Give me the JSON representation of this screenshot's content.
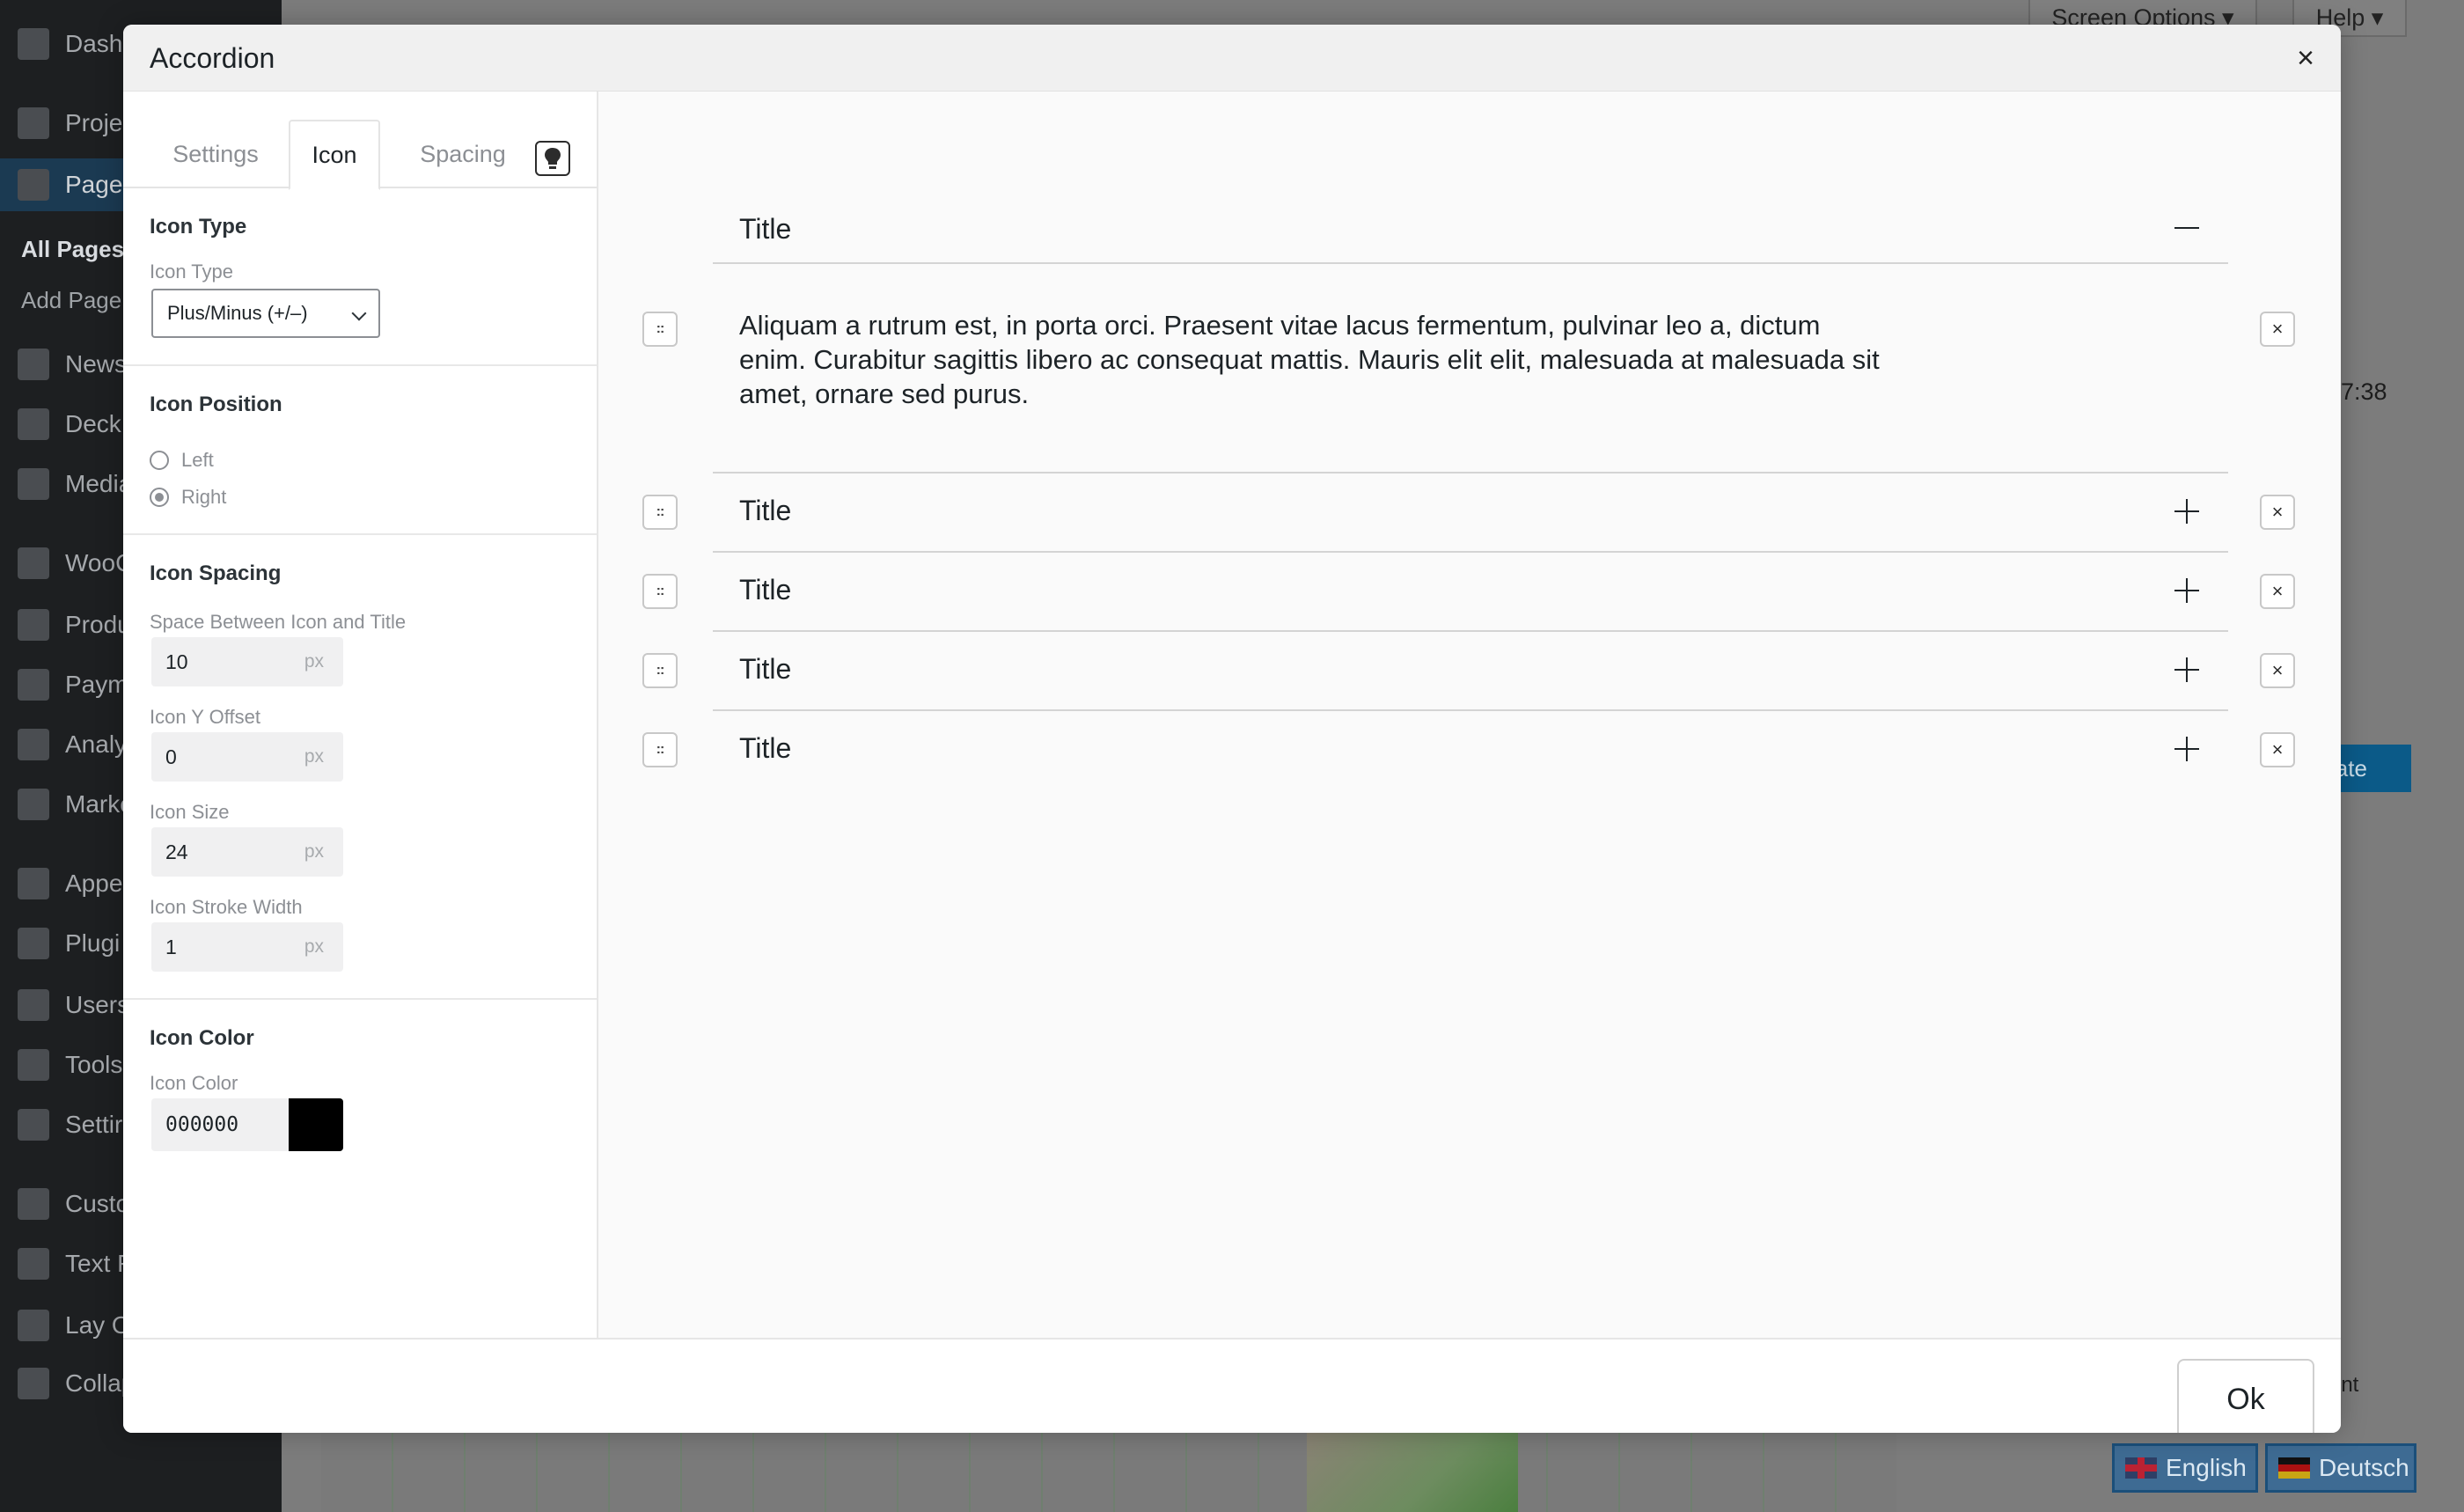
{
  "background": {
    "menu": [
      {
        "label": "Dash",
        "icon": "dashboard-icon"
      },
      {
        "label": "Proje",
        "icon": "pin-icon"
      },
      {
        "label": "Pages",
        "icon": "pages-icon",
        "current": true
      },
      {
        "label": "News",
        "icon": "news-icon"
      },
      {
        "label": "Deck",
        "icon": "deck-icon"
      },
      {
        "label": "Media",
        "icon": "media-icon"
      },
      {
        "label": "WooC",
        "icon": "woo-icon"
      },
      {
        "label": "Produ",
        "icon": "products-icon"
      },
      {
        "label": "Paym",
        "icon": "payments-icon"
      },
      {
        "label": "Analy",
        "icon": "analytics-icon"
      },
      {
        "label": "Marke",
        "icon": "marketing-icon"
      },
      {
        "label": "Appe",
        "icon": "appearance-icon"
      },
      {
        "label": "Plugi",
        "icon": "plugins-icon"
      },
      {
        "label": "Users",
        "icon": "users-icon"
      },
      {
        "label": "Tools",
        "icon": "tools-icon"
      },
      {
        "label": "Settir",
        "icon": "settings-icon"
      },
      {
        "label": "Custo",
        "icon": "eye-icon"
      },
      {
        "label": "Text F",
        "icon": "text-icon"
      },
      {
        "label": "Lay O",
        "icon": "gear-icon"
      },
      {
        "label": "Collap",
        "icon": "collapse-icon"
      }
    ],
    "submenu": [
      "All Pages",
      "Add Page"
    ],
    "screen_options": "Screen Options ▾",
    "help": "Help ▾",
    "time_fragment": "7:38",
    "update_fragment": "late",
    "int_fragment": "int",
    "languages": [
      "English",
      "Deutsch"
    ]
  },
  "modal": {
    "title": "Accordion",
    "close_symbol": "×",
    "tabs": [
      "Settings",
      "Icon",
      "Spacing"
    ],
    "active_tab": "Icon",
    "sections": {
      "icon_type": {
        "title": "Icon Type",
        "label": "Icon Type",
        "value": "Plus/Minus (+/–)"
      },
      "icon_position": {
        "title": "Icon Position",
        "options": [
          "Left",
          "Right"
        ],
        "selected": "Right"
      },
      "icon_spacing": {
        "title": "Icon Spacing",
        "fields": [
          {
            "label": "Space Between Icon and Title",
            "value": "10",
            "unit": "px"
          },
          {
            "label": "Icon Y Offset",
            "value": "0",
            "unit": "px"
          },
          {
            "label": "Icon Size",
            "value": "24",
            "unit": "px"
          },
          {
            "label": "Icon Stroke Width",
            "value": "1",
            "unit": "px"
          }
        ]
      },
      "icon_color": {
        "title": "Icon Color",
        "label": "Icon Color",
        "value": "000000",
        "swatch": "#000000"
      }
    },
    "preview": {
      "items": [
        {
          "title": "Title",
          "expanded": true,
          "body": "Aliquam a rutrum est, in porta orci. Praesent vitae lacus fermentum, pulvinar leo a, dictum enim. Curabitur sagittis libero ac consequat mattis. Mauris elit elit, malesuada at malesuada sit amet, ornare sed purus."
        },
        {
          "title": "Title",
          "expanded": false
        },
        {
          "title": "Title",
          "expanded": false
        },
        {
          "title": "Title",
          "expanded": false
        },
        {
          "title": "Title",
          "expanded": false
        }
      ],
      "drag_symbol": "::",
      "remove_symbol": "×"
    },
    "footer": {
      "ok_label": "Ok"
    }
  }
}
